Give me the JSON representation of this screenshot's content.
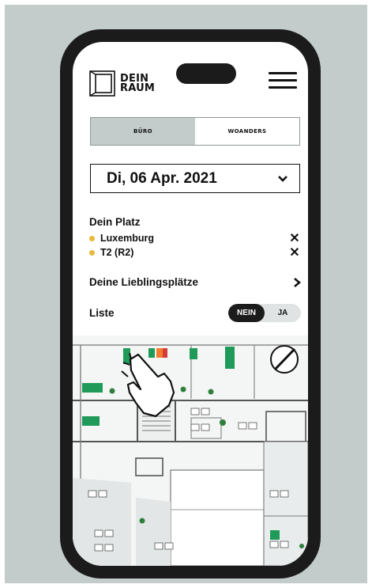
{
  "header": {
    "logo_line1": "DEIN",
    "logo_line2": "RAUM",
    "menu_icon": "hamburger-icon"
  },
  "location_tabs": [
    {
      "label": "BÜRO",
      "active": true
    },
    {
      "label": "WOANDERS",
      "active": false
    }
  ],
  "date_select": {
    "value": "Di, 06 Apr. 2021",
    "icon": "chevron-down-icon"
  },
  "my_place": {
    "title": "Dein Platz",
    "items": [
      {
        "label": "Luxemburg",
        "remove_icon": "close-icon"
      },
      {
        "label": "T2 (R2)",
        "remove_icon": "close-icon"
      }
    ]
  },
  "favorites": {
    "label": "Deine Lieblingsplätze",
    "icon": "chevron-right-icon"
  },
  "list_view": {
    "label": "Liste",
    "options": [
      "NEIN",
      "JA"
    ],
    "selected": "NEIN"
  },
  "floorplan": {
    "hand_icon": "tap-hand-icon",
    "no_edit_icon": "slash-icon"
  },
  "colors": {
    "frame_bg": "#c4cbcb",
    "accent_green": "#1f9a58",
    "dot_yellow": "#e6b93c",
    "orange": "#ef7d2c",
    "red": "#d63b3b"
  }
}
